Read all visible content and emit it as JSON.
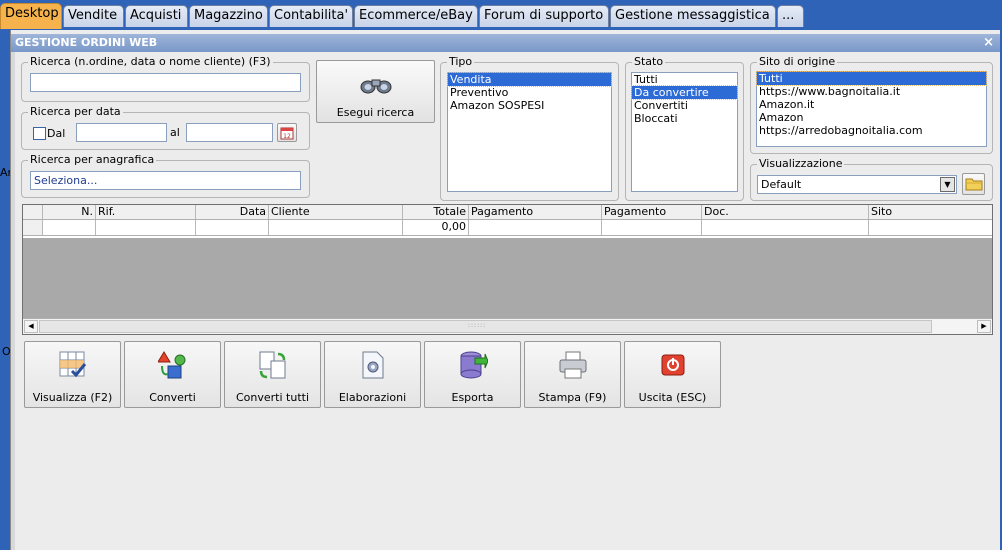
{
  "tabs": [
    {
      "label": "Desktop",
      "active": true
    },
    {
      "label": "Vendite"
    },
    {
      "label": "Acquisti"
    },
    {
      "label": "Magazzino"
    },
    {
      "label": "Contabilita'"
    },
    {
      "label": "Ecommerce/eBay"
    },
    {
      "label": "Forum di supporto"
    },
    {
      "label": "Gestione messaggistica"
    },
    {
      "label": "..."
    }
  ],
  "window": {
    "title": "GESTIONE ORDINI WEB",
    "close": "×"
  },
  "search": {
    "legend": "Ricerca (n.ordine, data o nome cliente) (F3)",
    "value": ""
  },
  "date_search": {
    "legend": "Ricerca per data",
    "from_label": "Dal",
    "to_label": "al",
    "from_value": "",
    "to_value": ""
  },
  "registry_search": {
    "legend": "Ricerca per anagrafica",
    "value": "Seleziona..."
  },
  "run_search": {
    "label": "Esegui ricerca"
  },
  "tipo": {
    "legend": "Tipo",
    "items": [
      "Vendita",
      "Preventivo",
      "Amazon SOSPESI"
    ],
    "selected": 0
  },
  "stato": {
    "legend": "Stato",
    "items": [
      "Tutti",
      "Da convertire",
      "Convertiti",
      "Bloccati"
    ],
    "selected": 1
  },
  "sito": {
    "legend": "Sito di origine",
    "items": [
      "Tutti",
      "https://www.bagnoitalia.it",
      "Amazon.it",
      "Amazon",
      "https://arredobagnoitalia.com"
    ],
    "selected": 0
  },
  "visualizzazione": {
    "legend": "Visualizzazione",
    "value": "Default"
  },
  "grid": {
    "columns": [
      "N.",
      "Rif.",
      "Data",
      "Cliente",
      "Totale",
      "Pagamento",
      "Pagamento",
      "Doc.",
      "Sito"
    ],
    "row": [
      "",
      "",
      "",
      "",
      "0,00",
      "",
      "",
      "",
      ""
    ]
  },
  "toolbar": [
    {
      "label": "Visualizza (F2)",
      "icon": "grid-check-icon"
    },
    {
      "label": "Converti",
      "icon": "convert-shapes-icon"
    },
    {
      "label": "Converti tutti",
      "icon": "convert-documents-icon"
    },
    {
      "label": "Elaborazioni",
      "icon": "gear-document-icon"
    },
    {
      "label": "Esporta",
      "icon": "database-export-icon"
    },
    {
      "label": "Stampa (F9)",
      "icon": "printer-icon"
    },
    {
      "label": "Uscita (ESC)",
      "icon": "power-exit-icon"
    }
  ],
  "stray_text": {
    "a": "An",
    "b": "O"
  }
}
